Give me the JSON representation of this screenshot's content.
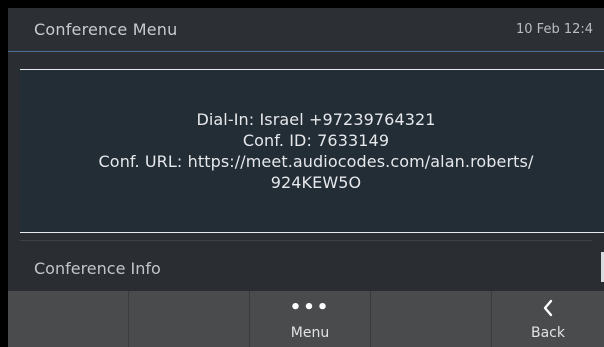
{
  "header": {
    "title": "Conference Menu",
    "datetime": "10 Feb 12:4"
  },
  "popup": {
    "lines": [
      "Dial-In: Israel +97239764321",
      "Conf. ID: 7633149",
      "Conf. URL: https://meet.audiocodes.com/alan.roberts/",
      "924KEW5O"
    ]
  },
  "list": {
    "items": [
      {
        "label": "Conference Info"
      }
    ]
  },
  "softkeys": [
    {
      "label": "",
      "icon": ""
    },
    {
      "label": "",
      "icon": ""
    },
    {
      "label": "Menu",
      "icon": "more-dots-icon"
    },
    {
      "label": "",
      "icon": ""
    },
    {
      "label": "Back",
      "icon": "chevron-left-icon"
    }
  ],
  "colors": {
    "header_border": "#4a6f92",
    "popup_bg": "#232d36",
    "softkey_bar": "#4a4b4d",
    "screen_bg": "#2a2d31"
  }
}
